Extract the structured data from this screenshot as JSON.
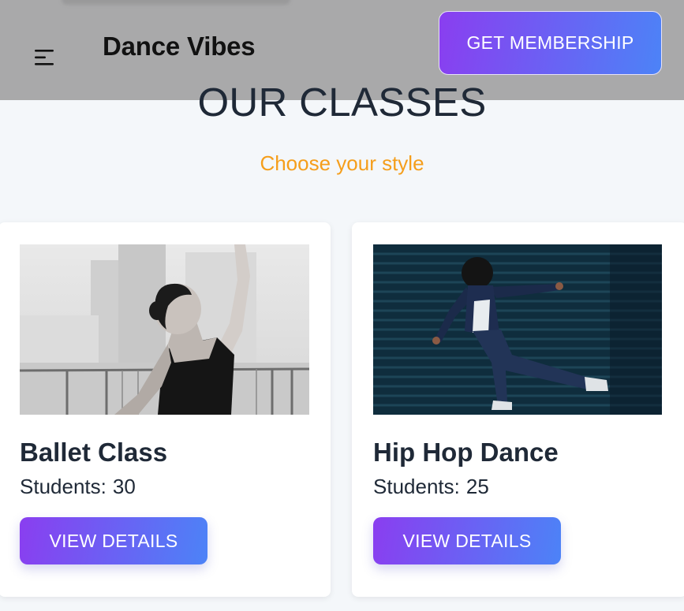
{
  "header": {
    "brand": "Dance Vibes",
    "membership_label": "GET MEMBERSHIP",
    "menu_icon": "menu-icon"
  },
  "section": {
    "title": "OUR CLASSES",
    "subtitle": "Choose your style"
  },
  "classes": [
    {
      "title": "Ballet Class",
      "students_label": "Students:",
      "students": "30",
      "button_label": "VIEW DETAILS",
      "image": "ballet-dancer-photo"
    },
    {
      "title": "Hip Hop Dance",
      "students_label": "Students:",
      "students": "25",
      "button_label": "VIEW DETAILS",
      "image": "hip-hop-dancer-photo"
    }
  ],
  "colors": {
    "accent_gradient_start": "#8a3ef0",
    "accent_gradient_end": "#4c83f7",
    "subtitle": "#f59e1b",
    "header_bg": "#a9a9aa",
    "page_bg": "#f4f7fa"
  }
}
